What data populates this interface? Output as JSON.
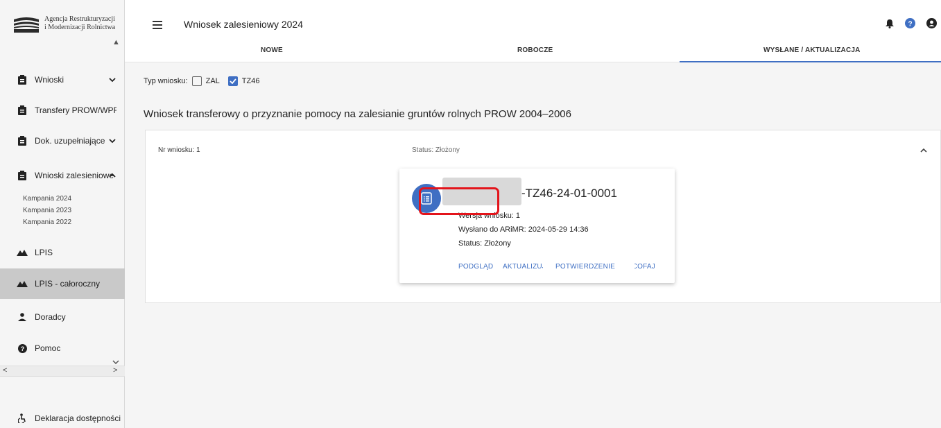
{
  "sidebar": {
    "logo_line1": "Agencja Restrukturyzacji",
    "logo_line2": "i Modernizacji Rolnictwa",
    "items": [
      {
        "label": "Wnioski",
        "icon": "clipboard-icon"
      },
      {
        "label": "Transfery PROW/WPR",
        "icon": "clipboard-icon"
      },
      {
        "label": "Dok. uzupełniające",
        "icon": "clipboard-icon"
      },
      {
        "label": "Wnioski zalesieniowe",
        "icon": "clipboard-icon"
      },
      {
        "label": "LPIS",
        "icon": "terrain-icon"
      },
      {
        "label": "LPIS - całoroczny",
        "icon": "terrain-icon"
      },
      {
        "label": "Doradcy",
        "icon": "person-icon"
      },
      {
        "label": "Pomoc",
        "icon": "help-icon"
      }
    ],
    "sub_links": [
      "Kampania 2024",
      "Kampania 2023",
      "Kampania 2022"
    ],
    "accessibility": "Deklaracja dostępności"
  },
  "header": {
    "title": "Wniosek zalesieniowy 2024"
  },
  "tabs": [
    "NOWE",
    "ROBOCZE",
    "WYSŁANE / AKTUALIZACJA"
  ],
  "filter": {
    "label": "Typ wniosku:",
    "options": [
      {
        "label": "ZAL",
        "checked": false
      },
      {
        "label": "TZ46",
        "checked": true
      }
    ]
  },
  "section_title": "Wniosek transferowy o przyznanie pomocy na zalesianie gruntów rolnych PROW 2004–2006",
  "panel": {
    "nr_label": "Nr wniosku: 1",
    "status_label": "Status: Złożony"
  },
  "card": {
    "doc_id_suffix": "-TZ46-24-01-0001",
    "version": "Wersja wniosku: 1",
    "sent": "Wysłano do ARiMR: 2024-05-29 14:36",
    "status": "Status: Złożony",
    "actions": [
      "PODGLĄD",
      "AKTUALIZUJ",
      "POTWIERDZENIE",
      "WYCOFAJ"
    ]
  },
  "colors": {
    "accent": "#3f6fc3",
    "highlight": "#e3141b"
  }
}
